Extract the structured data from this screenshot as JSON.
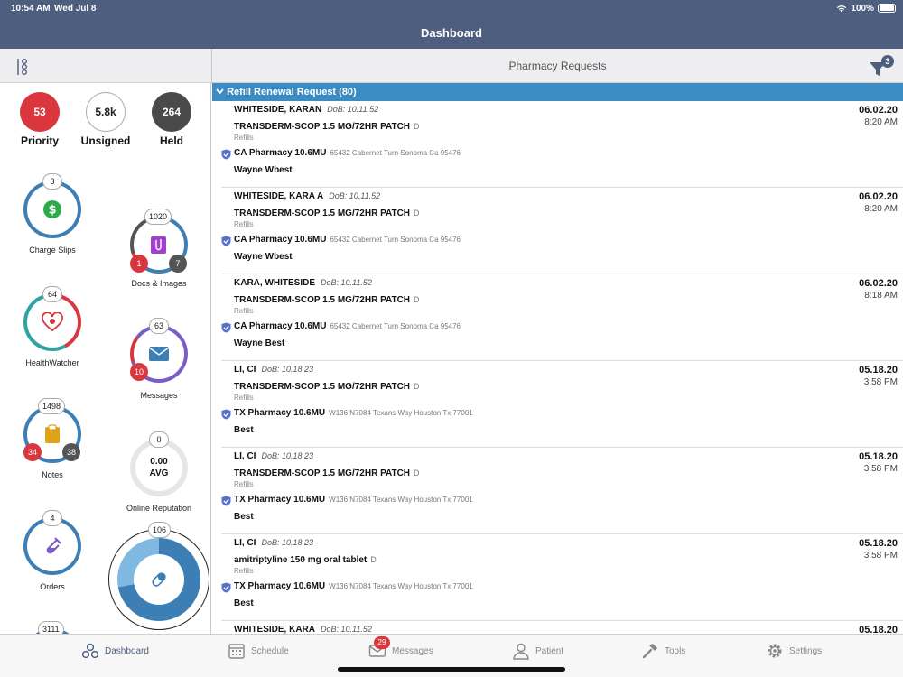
{
  "status": {
    "time": "10:54 AM",
    "date": "Wed Jul 8",
    "battery": "100%"
  },
  "header": {
    "title": "Dashboard"
  },
  "panel": {
    "title": "Pharmacy Requests",
    "filter_count": "3"
  },
  "stats": [
    {
      "value": "53",
      "label": "Priority",
      "color": "#d9363e"
    },
    {
      "value": "5.8k",
      "label": "Unsigned",
      "color": "#ffffff"
    },
    {
      "value": "264",
      "label": "Held",
      "color": "#4a4a4a"
    }
  ],
  "widgets": {
    "charge_slips": {
      "count": "3",
      "label": "Charge Slips"
    },
    "docs_images": {
      "count": "1020",
      "badge_left": "1",
      "badge_right": "7",
      "label": "Docs & Images"
    },
    "healthwatcher": {
      "count": "64",
      "label": "HealthWatcher"
    },
    "messages": {
      "count": "63",
      "badge_left": "10",
      "label": "Messages"
    },
    "notes": {
      "count": "1498",
      "badge_left": "34",
      "badge_right": "38",
      "label": "Notes"
    },
    "online_reputation": {
      "count": "0",
      "value": "0.00",
      "unit": "AVG",
      "label": "Online Reputation"
    },
    "orders": {
      "count": "4",
      "label": "Orders"
    },
    "rx_widget": {
      "count": "106"
    },
    "partial_widget": {
      "count": "3111"
    }
  },
  "group": {
    "label": "Refill Renewal Request (80)"
  },
  "requests": [
    {
      "patient": "WHITESIDE, KARAN",
      "dob": "DoB: 10.11.52",
      "date": "06.02.20",
      "time": "8:20 AM",
      "drug": "TRANSDERM-SCOP 1.5 MG/72HR PATCH",
      "flag": "D",
      "refills": "Refills",
      "pharmacy": "CA Pharmacy 10.6MU",
      "address": "65432 Cabernet Turn  Sonoma Ca 95476",
      "prescriber": "Wayne Wbest"
    },
    {
      "patient": "WHITESIDE, KARA A",
      "dob": "DoB: 10.11.52",
      "date": "06.02.20",
      "time": "8:20 AM",
      "drug": "TRANSDERM-SCOP 1.5 MG/72HR PATCH",
      "flag": "D",
      "refills": "Refills",
      "pharmacy": "CA Pharmacy 10.6MU",
      "address": "65432 Cabernet Turn  Sonoma Ca 95476",
      "prescriber": "Wayne Wbest"
    },
    {
      "patient": "KARA, WHITESIDE",
      "dob": "DoB: 10.11.52",
      "date": "06.02.20",
      "time": "8:18 AM",
      "drug": "TRANSDERM-SCOP 1.5 MG/72HR PATCH",
      "flag": "D",
      "refills": "Refills",
      "pharmacy": "CA Pharmacy 10.6MU",
      "address": "65432 Cabernet Turn  Sonoma Ca 95476",
      "prescriber": "Wayne Best"
    },
    {
      "patient": "LI, CI",
      "dob": "DoB: 10.18.23",
      "date": "05.18.20",
      "time": "3:58 PM",
      "drug": "TRANSDERM-SCOP 1.5 MG/72HR PATCH",
      "flag": "D",
      "refills": "Refills",
      "pharmacy": "TX Pharmacy 10.6MU",
      "address": "W136 N7084 Texans Way  Houston Tx 77001",
      "prescriber": "Best"
    },
    {
      "patient": "LI, CI",
      "dob": "DoB: 10.18.23",
      "date": "05.18.20",
      "time": "3:58 PM",
      "drug": "TRANSDERM-SCOP 1.5 MG/72HR PATCH",
      "flag": "D",
      "refills": "Refills",
      "pharmacy": "TX Pharmacy 10.6MU",
      "address": "W136 N7084 Texans Way  Houston Tx 77001",
      "prescriber": "Best"
    },
    {
      "patient": "LI, CI",
      "dob": "DoB: 10.18.23",
      "date": "05.18.20",
      "time": "3:58 PM",
      "drug": "amitriptyline 150 mg oral tablet",
      "flag": "D",
      "refills": "Refills",
      "pharmacy": "TX Pharmacy 10.6MU",
      "address": "W136 N7084 Texans Way  Houston Tx 77001",
      "prescriber": "Best"
    },
    {
      "patient": "WHITESIDE, KARA",
      "dob": "DoB: 10.11.52",
      "date": "05.18.20",
      "time": "",
      "drug": "",
      "flag": "",
      "refills": "",
      "pharmacy": "",
      "address": "",
      "prescriber": ""
    }
  ],
  "tabs": [
    {
      "label": "Dashboard",
      "icon": "dashboard-icon"
    },
    {
      "label": "Schedule",
      "icon": "calendar-icon"
    },
    {
      "label": "Messages",
      "icon": "envelope-icon",
      "badge": "29"
    },
    {
      "label": "Patient",
      "icon": "person-icon"
    },
    {
      "label": "Tools",
      "icon": "hammer-icon"
    },
    {
      "label": "Settings",
      "icon": "gear-icon"
    }
  ]
}
